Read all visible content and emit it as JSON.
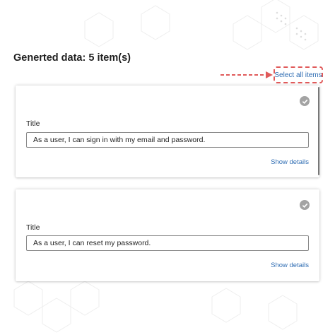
{
  "header": {
    "title": "Generted data: 5 item(s)"
  },
  "toolbar": {
    "select_all_label": "Select all items"
  },
  "items": [
    {
      "field_label": "Title",
      "value": "As a user, I can sign in with my email and password.",
      "details_label": "Show details"
    },
    {
      "field_label": "Title",
      "value": "As a user, I can reset my password.",
      "details_label": "Show details"
    }
  ],
  "colors": {
    "link": "#2f6db3",
    "highlight": "#e05a5a",
    "check": "#a3a3a3"
  },
  "icons": {
    "card_status": "checkmark-circle-icon",
    "pointer": "dashed-arrow-icon"
  }
}
